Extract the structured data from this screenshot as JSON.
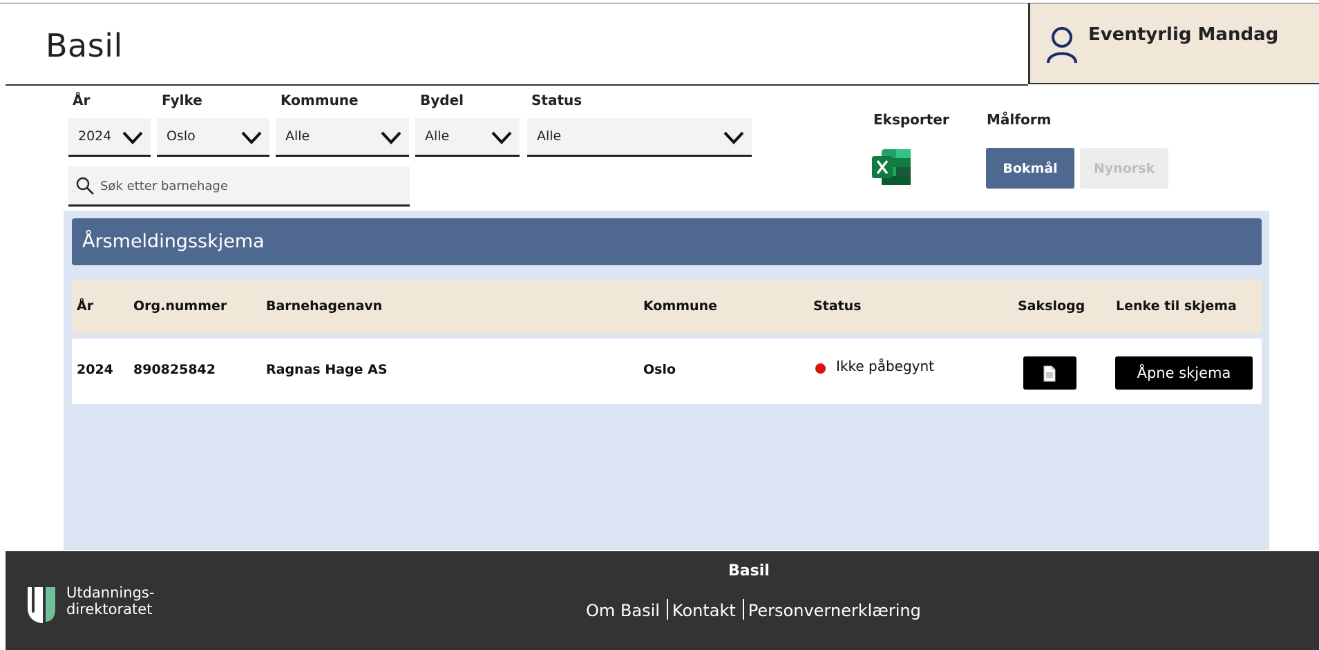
{
  "header": {
    "app_title": "Basil",
    "user_name": "Eventyrlig Mandag"
  },
  "filters": {
    "year": {
      "label": "År",
      "value": "2024"
    },
    "county": {
      "label": "Fylke",
      "value": "Oslo"
    },
    "municipality": {
      "label": "Kommune",
      "value": "Alle"
    },
    "district": {
      "label": "Bydel",
      "value": "Alle"
    },
    "status": {
      "label": "Status",
      "value": "Alle"
    }
  },
  "search": {
    "placeholder": "Søk etter barnehage"
  },
  "export": {
    "label": "Eksporter",
    "icon": "excel-icon"
  },
  "language": {
    "label": "Målform",
    "bokmal": "Bokmål",
    "nynorsk": "Nynorsk"
  },
  "panel": {
    "title": "Årsmeldingsskjema",
    "columns": [
      "År",
      "Org.nummer",
      "Barnehagenavn",
      "Kommune",
      "Status",
      "Sakslogg",
      "Lenke til skjema"
    ],
    "rows": [
      {
        "year": "2024",
        "org_number": "890825842",
        "name": "Ragnas Hage AS",
        "municipality": "Oslo",
        "status": "Ikke påbegynt",
        "status_color": "#e01010",
        "open_label": "Åpne skjema"
      }
    ]
  },
  "footer": {
    "logo_line1": "Utdannings-",
    "logo_line2": "direktoratet",
    "title": "Basil",
    "links": [
      "Om Basil",
      "Kontakt",
      "Personvernerklæring"
    ]
  },
  "colors": {
    "accent": "#4e6890",
    "beige": "#f1e7d9",
    "panel_bg": "#dce5f3",
    "footer_bg": "#333333"
  }
}
